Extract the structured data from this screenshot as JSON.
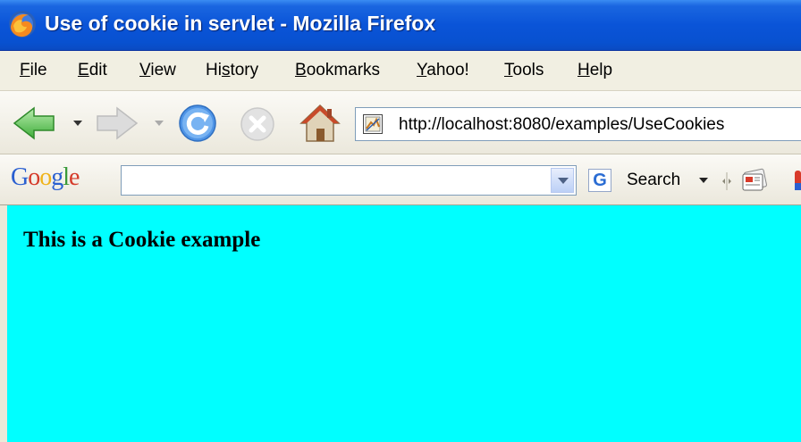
{
  "window": {
    "title": "Use of cookie in servlet - Mozilla Firefox"
  },
  "menu": {
    "items": [
      {
        "label": "File",
        "accel": "F"
      },
      {
        "label": "Edit",
        "accel": "E"
      },
      {
        "label": "View",
        "accel": "V"
      },
      {
        "label": "History",
        "accel": "s"
      },
      {
        "label": "Bookmarks",
        "accel": "B"
      },
      {
        "label": "Yahoo!",
        "accel": "Y"
      },
      {
        "label": "Tools",
        "accel": "T"
      },
      {
        "label": "Help",
        "accel": "H"
      }
    ]
  },
  "navigation": {
    "back_icon": "back-arrow-icon",
    "forward_icon": "forward-arrow-icon",
    "reload_icon": "reload-icon",
    "stop_icon": "stop-icon",
    "home_icon": "home-icon",
    "url": "http://localhost:8080/examples/UseCookies"
  },
  "google_toolbar": {
    "logo": "Google",
    "search_value": "",
    "search_button_label": "Search",
    "search_button_glyph": "G"
  },
  "page": {
    "heading": "This is a Cookie example",
    "background": "#00ffff"
  },
  "colors": {
    "titlebar": "#0a54d8",
    "accent": "#2a6cd3"
  }
}
